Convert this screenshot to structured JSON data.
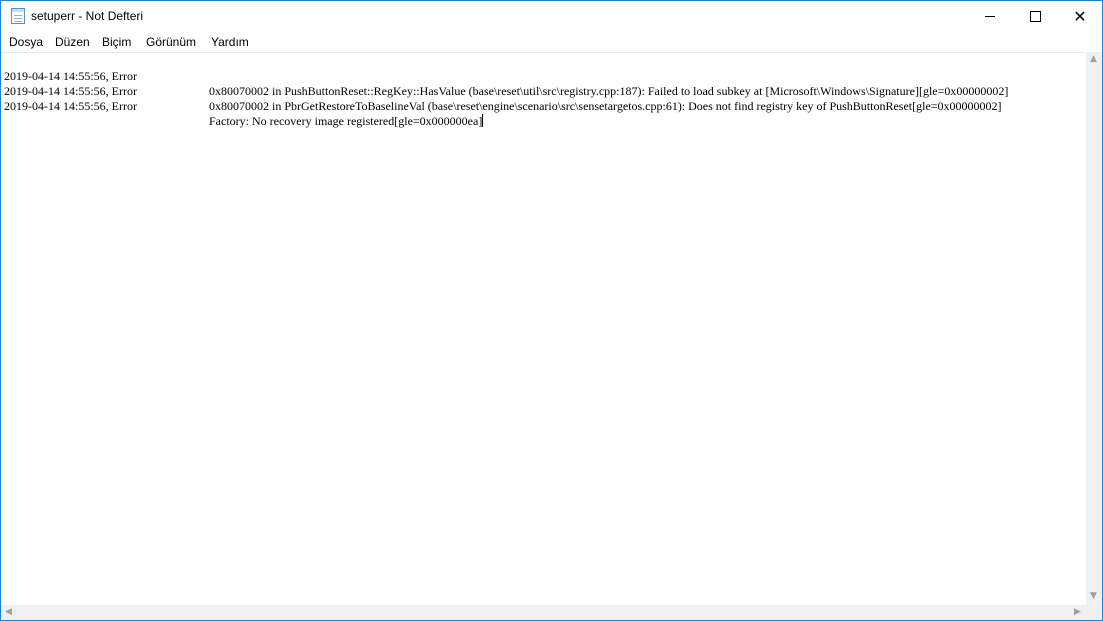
{
  "window": {
    "title": "setuperr - Not Defteri",
    "controls": {
      "minimize": "",
      "maximize": "",
      "close": "✕"
    }
  },
  "menu": [
    "Dosya",
    "Düzen",
    "Biçim",
    "Görünüm",
    "Yardım"
  ],
  "lines": [
    {
      "timestamp": "2019-04-14 14:55:56, Error",
      "message": "0x80070002 in PushButtonReset::RegKey::HasValue (base\\reset\\util\\src\\registry.cpp:187): Failed to load subkey at [Microsoft\\Windows\\Signature][gle=0x00000002]"
    },
    {
      "timestamp": "2019-04-14 14:55:56, Error",
      "message": "0x80070002 in PbrGetRestoreToBaselineVal (base\\reset\\engine\\scenario\\src\\sensetargetos.cpp:61): Does not find registry key of PushButtonReset[gle=0x00000002]"
    },
    {
      "timestamp": "2019-04-14 14:55:56, Error",
      "message": "Factory: No recovery image registered[gle=0x000000ea]"
    }
  ],
  "scroll_arrows": {
    "up": "▲",
    "down": "▼",
    "left": "◀",
    "right": "▶"
  },
  "colors": {
    "window_border": "#1883d7",
    "scrollbar": "#f0f0f0"
  },
  "icons": {
    "app": "notepad-icon"
  }
}
